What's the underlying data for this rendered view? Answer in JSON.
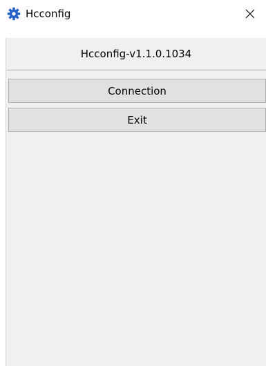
{
  "window": {
    "title": "Hcconfig",
    "icon": "gear-icon",
    "close_icon": "close-icon"
  },
  "main": {
    "version": "Hcconfig-v1.1.0.1034",
    "buttons": {
      "connection": "Connection",
      "exit": "Exit"
    }
  },
  "colors": {
    "icon_blue": "#2a62c9",
    "client_bg": "#f0f0f0",
    "button_bg": "#e1e1e1",
    "button_border": "#adadad"
  }
}
